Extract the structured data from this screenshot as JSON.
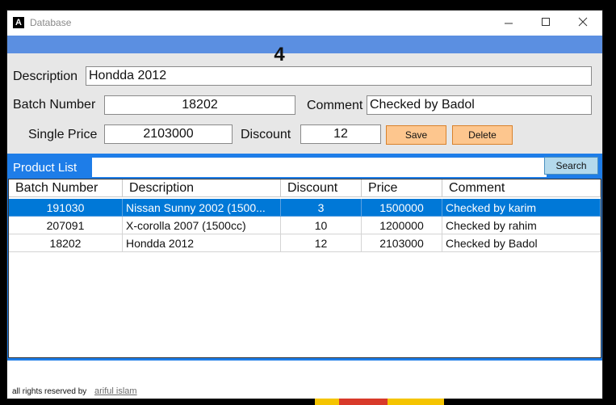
{
  "window": {
    "title": "Database",
    "app_icon": "A"
  },
  "counter": "4",
  "form": {
    "description_label": "Description",
    "description_value": "Hondda 2012",
    "batch_label": "Batch Number",
    "batch_value": "18202",
    "comment_label": "Comment",
    "comment_value": "Checked by Badol",
    "price_label": "Single Price",
    "price_value": "2103000",
    "discount_label": "Discount",
    "discount_value": "12",
    "save_label": "Save",
    "delete_label": "Delete"
  },
  "list": {
    "title": "Product List",
    "search_value": "",
    "search_label": "Search",
    "columns": [
      "Batch Number",
      "Description",
      "Discount",
      "Price",
      "Comment"
    ],
    "rows": [
      [
        "191030",
        "Nissan Sunny 2002 (1500...",
        "3",
        "1500000",
        "Checked by karim"
      ],
      [
        "207091",
        "X-corolla 2007 (1500cc)",
        "10",
        "1200000",
        "Checked by rahim"
      ],
      [
        "18202",
        "Hondda 2012",
        "12",
        "2103000",
        "Checked by Badol"
      ]
    ],
    "selected_row": 0
  },
  "footer": {
    "text": "all rights reserved by",
    "link": "ariful islam"
  },
  "colors": {
    "accent": "#1e7de8",
    "strip": "#5b8fe1",
    "button": "#fdc68e",
    "selection": "#0078d7"
  }
}
